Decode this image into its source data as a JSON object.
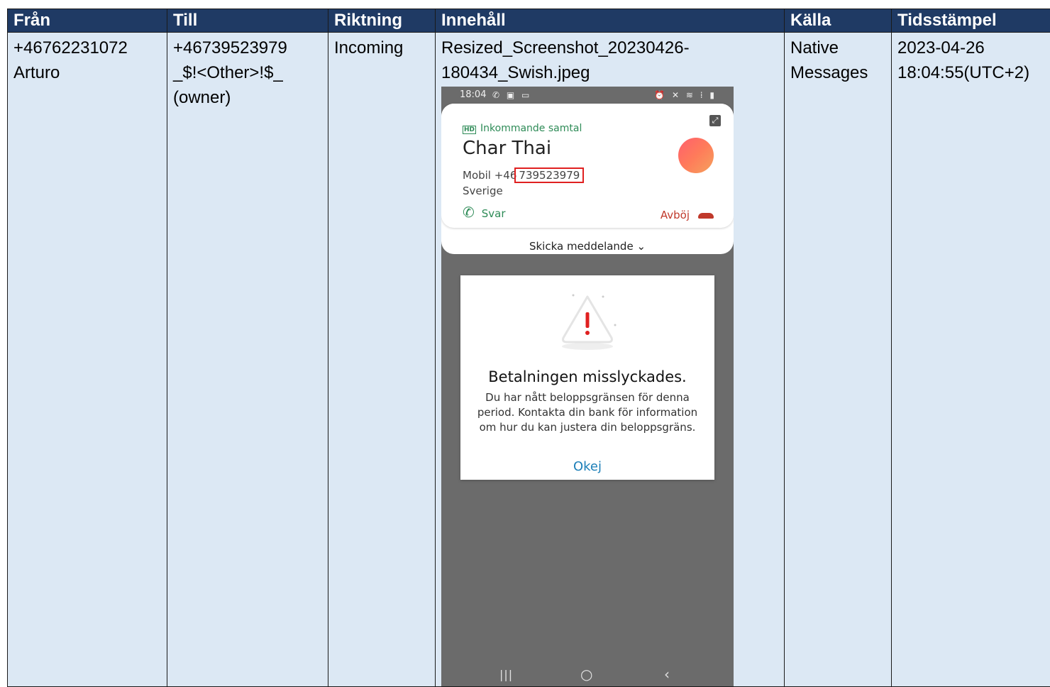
{
  "table": {
    "headers": {
      "from": "Från",
      "to": "Till",
      "direction": "Riktning",
      "content": "Innehåll",
      "source": "Källa",
      "timestamp": "Tidsstämpel"
    },
    "row": {
      "from_number": "+46762231072",
      "from_name": "Arturo",
      "to_number": "+46739523979",
      "to_tag": "_$!<Other>!$_",
      "to_role": "(owner)",
      "direction": "Incoming",
      "content_filename_line1": "Resized_Screenshot_20230426-",
      "content_filename_line2": "180434_Swish.jpeg",
      "source_line1": "Native",
      "source_line2": "Messages",
      "timestamp_date": "2023-04-26",
      "timestamp_time": "18:04:55(UTC+2)"
    }
  },
  "screenshot": {
    "status_time": "18:04",
    "status_left_icons": "✆ ▣ ▭",
    "status_right_icons": "⏰ ✕ ≋ ⁞ ▮",
    "call_label_badge": "HD",
    "call_label": "Inkommande samtal",
    "caller_name": "Char Thai",
    "caller_number_prefix": "Mobil +46",
    "caller_number_highlight": "739523979",
    "caller_country": "Sverige",
    "answer_label": "Svar",
    "decline_label": "Avböj",
    "send_message_label": "Skicka meddelande ⌄",
    "dialog_title": "Betalningen misslyckades.",
    "dialog_body": "Du har nått beloppsgränsen för denna period. Kontakta din bank för information om hur du kan justera din beloppsgräns.",
    "dialog_ok": "Okej",
    "nav_recent": "|||",
    "nav_home": "○",
    "nav_back": "‹",
    "colors": {
      "header_bg": "#1f3a64",
      "cell_bg": "#dce8f4",
      "phone_bg": "#6b6b6b",
      "accent_green": "#2e8b57",
      "decline_red": "#c0392b",
      "highlight_red": "#e02020",
      "link_blue": "#1c7fb8"
    }
  }
}
